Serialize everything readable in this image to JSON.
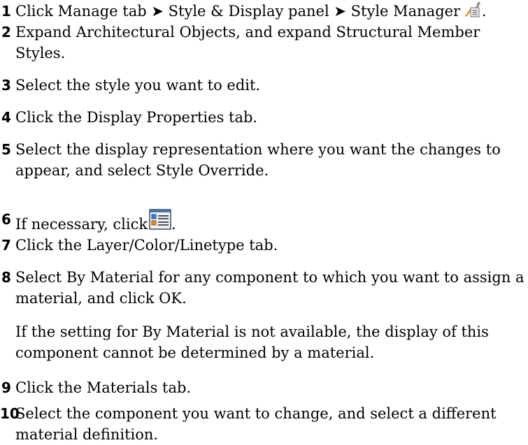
{
  "steps": [
    {
      "num": "1",
      "before": "Click Manage tab ➤ Style & Display panel ➤ Style Manager",
      "after": ".",
      "icon": "style-manager-icon"
    },
    {
      "num": "2",
      "text": "Expand Architectural Objects, and expand Structural Member Styles."
    },
    {
      "num": "3",
      "text": "Select the style you want to edit."
    },
    {
      "num": "4",
      "text": "Click the Display Properties tab."
    },
    {
      "num": "5",
      "text": "Select the display representation where you want the changes to appear, and select Style Override."
    },
    {
      "num": "6",
      "before": "If necessary, click",
      "after": ".",
      "icon": "edit-display-properties-icon"
    },
    {
      "num": "7",
      "text": "Click the Layer/Color/Linetype tab."
    },
    {
      "num": "8",
      "text": "Select By Material for any component to which you want to assign a material, and click OK."
    },
    {
      "num": "9",
      "text": "Click the Materials tab."
    },
    {
      "num": "10",
      "text": "Select the component you want to change, and select a different material definition."
    }
  ],
  "note": "If the setting for By Material is not available, the display of this component cannot be determined by a material."
}
